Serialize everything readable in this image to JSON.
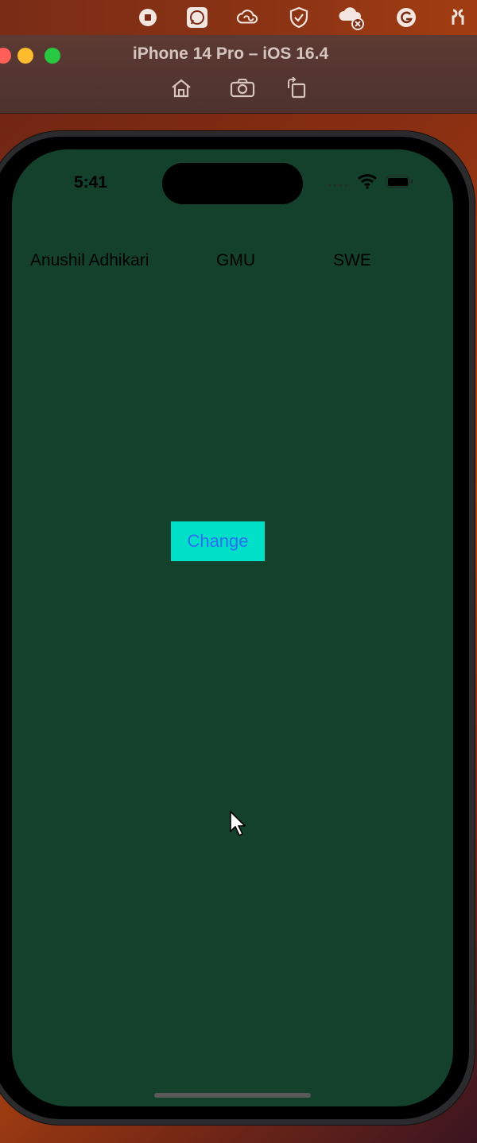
{
  "menubar": {
    "icons": [
      "record-stop-icon",
      "whatsapp-icon",
      "creative-cloud-icon",
      "vpn-shield-icon",
      "cloud-error-icon",
      "grammarly-icon",
      "airpods-icon"
    ]
  },
  "window": {
    "title": "iPhone 14 Pro – iOS 16.4",
    "toolbar": [
      "home-icon",
      "screenshot-icon",
      "rotate-icon"
    ]
  },
  "status_bar": {
    "time": "5:41"
  },
  "app": {
    "labels": {
      "name": "Anushil Adhikari",
      "school": "GMU",
      "major": "SWE"
    },
    "change_button": "Change",
    "colors": {
      "background": "#13412b",
      "button_background": "#00e0c8",
      "button_text": "#2f6df3",
      "label_text": "#000000"
    }
  }
}
